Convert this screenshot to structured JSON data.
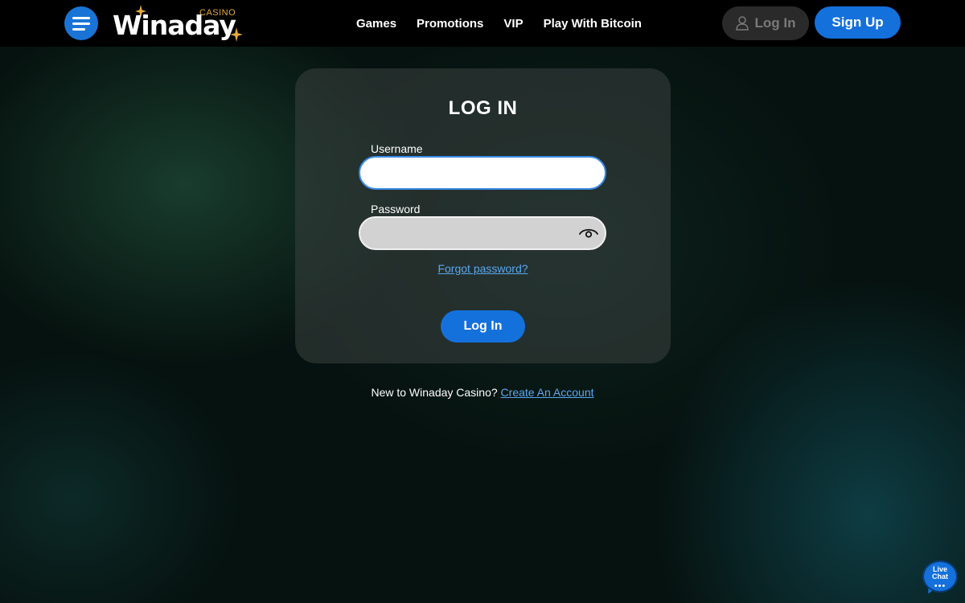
{
  "header": {
    "brand": {
      "wordmark": "Winaday",
      "sub": "CASINO",
      "star_color": "#e4ab3c"
    },
    "menu_icon": "hamburger-icon",
    "nav": [
      {
        "label": "Games"
      },
      {
        "label": "Promotions"
      },
      {
        "label": "VIP"
      },
      {
        "label": "Play With Bitcoin"
      }
    ],
    "login_label": "Log In",
    "login_icon": "user-icon",
    "signup_label": "Sign Up"
  },
  "login_form": {
    "title": "LOG IN",
    "username": {
      "label": "Username",
      "value": "",
      "placeholder": ""
    },
    "password": {
      "label": "Password",
      "value": "",
      "placeholder": "",
      "toggle_icon": "eye-icon"
    },
    "forgot_label": "Forgot password?",
    "submit_label": "Log In"
  },
  "footer_prompt": {
    "text": "New to Winaday Casino?",
    "link_label": "Create An Account"
  },
  "live_chat": {
    "line1": "Live",
    "line2": "Chat",
    "dots": "•••"
  },
  "colors": {
    "accent": "#1471dc",
    "link": "#5aa7ef",
    "brand_gold": "#e4ab3c"
  }
}
